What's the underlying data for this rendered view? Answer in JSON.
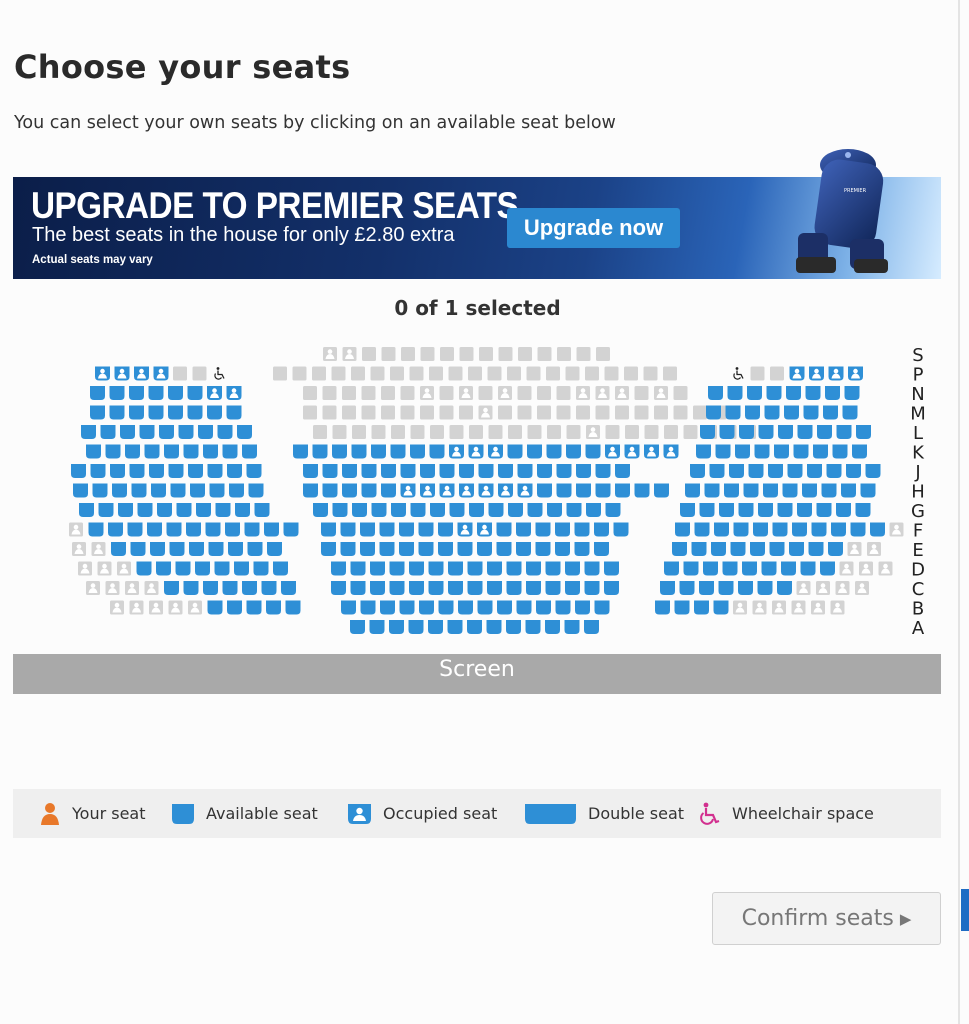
{
  "page": {
    "title": "Choose your seats",
    "intro": "You can select your own seats by clicking on an available seat below"
  },
  "banner": {
    "headline": "UPGRADE TO PREMIER SEATS",
    "subline": "The best seats in the house for only £2.80 extra",
    "note": "Actual seats may vary",
    "button": "Upgrade now",
    "chair_label": "PREMIER"
  },
  "selection": {
    "status": "0 of 1 selected"
  },
  "row_labels": [
    "S",
    "P",
    "N",
    "M",
    "L",
    "K",
    "J",
    "H",
    "G",
    "F",
    "E",
    "D",
    "C",
    "B",
    "A"
  ],
  "screen_label": "Screen",
  "legend": [
    {
      "key": "your_seat",
      "label": "Your seat",
      "icon": "your-seat-icon"
    },
    {
      "key": "available",
      "label": "Available seat",
      "icon": "available-seat-icon"
    },
    {
      "key": "occupied",
      "label": "Occupied seat",
      "icon": "occupied-seat-icon"
    },
    {
      "key": "double",
      "label": "Double seat",
      "icon": "double-seat-icon"
    },
    {
      "key": "wheelchair",
      "label": "Wheelchair space",
      "icon": "wheelchair-icon"
    }
  ],
  "confirm_button": "Confirm seats",
  "colors": {
    "available": "#2e8fd6",
    "premier_occupied": "#d3d3d3",
    "your_seat": "#e8782a",
    "wheelchair": "#d2308f",
    "screen": "#a9a9a9"
  },
  "seat_rows": [
    {
      "row": "S",
      "blocks": [
        "",
        "ooPPPPPPPPPPPPP",
        ""
      ]
    },
    {
      "row": "P",
      "blocks": [
        "OOOOppw",
        "PPPPPPPPPPPPPPPPPPPPP",
        "wppOOOO"
      ]
    },
    {
      "row": "N",
      "blocks": [
        "aaaaaaOO",
        "PPPPPPoPoPoPPPoooPoP",
        "aaaaaaaa"
      ]
    },
    {
      "row": "M",
      "blocks": [
        "aaaaaaaa",
        "PPPPPPPPPoPPPPPPPPPPPP",
        "aaaaaaaa"
      ]
    },
    {
      "row": "L",
      "blocks": [
        "aaaaaaaaa",
        "PPPPPPPPPPPPPPoPPPPPPPP",
        "aaaaaaaaa"
      ]
    },
    {
      "row": "K",
      "blocks": [
        "aaaaaaaaa",
        "aaaaaaaaOOOaaaaaOOOO",
        "aaaaaaaaa"
      ]
    },
    {
      "row": "J",
      "blocks": [
        "aaaaaaaaaa",
        "aaaaaaaaaaaaaaaaa",
        "aaaaaaaaaa"
      ]
    },
    {
      "row": "H",
      "blocks": [
        "aaaaaaaaaa",
        "aaaaaOOOOOOOaaaaaaa",
        "aaaaaaaaaa"
      ]
    },
    {
      "row": "G",
      "blocks": [
        "aaaaaaaaaa",
        "aaaaaaaaaaaaaaaa",
        "aaaaaaaaaa"
      ]
    },
    {
      "row": "F",
      "blocks": [
        "oaaaaaaaaaaa",
        "aaaaaaaOOaaaaaaa",
        "aaaaaaaaaaao"
      ]
    },
    {
      "row": "E",
      "blocks": [
        "ooaaaaaaaaa",
        "aaaaaaaaaaaaaaa",
        "aaaaaaaaaoo"
      ]
    },
    {
      "row": "D",
      "blocks": [
        "oooaaaaaaaa",
        "aaaaaaaaaaaaaaa",
        "aaaaaaaaaooo"
      ]
    },
    {
      "row": "C",
      "blocks": [
        "ooooaaaaaaa",
        "aaaaaaaaaaaaaaa",
        "aaaaaaaoooo"
      ]
    },
    {
      "row": "B",
      "blocks": [
        "oooooaaaaa",
        "aaaaaaaaaaaaaa",
        "aaaaoooooo"
      ]
    },
    {
      "row": "A",
      "blocks": [
        "",
        "aaaaaaaaaaaaa",
        ""
      ]
    }
  ]
}
